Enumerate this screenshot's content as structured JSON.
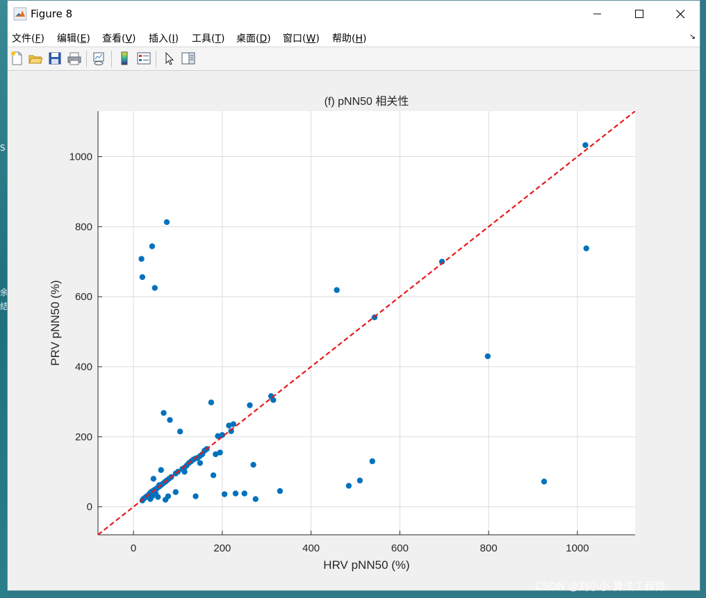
{
  "window": {
    "title": "Figure 8",
    "app_icon": "matlab-logo-icon"
  },
  "desktop": {
    "fragments": [
      "S",
      "余",
      "结"
    ]
  },
  "menu": [
    {
      "label": "文件(F)",
      "mn": "F"
    },
    {
      "label": "编辑(E)",
      "mn": "E"
    },
    {
      "label": "查看(V)",
      "mn": "V"
    },
    {
      "label": "插入(I)",
      "mn": "I"
    },
    {
      "label": "工具(T)",
      "mn": "T"
    },
    {
      "label": "桌面(D)",
      "mn": "D"
    },
    {
      "label": "窗口(W)",
      "mn": "W"
    },
    {
      "label": "帮助(H)",
      "mn": "H"
    }
  ],
  "menu_corner": "↘",
  "toolbar": [
    {
      "name": "new-figure-icon"
    },
    {
      "name": "open-file-icon"
    },
    {
      "name": "save-icon"
    },
    {
      "name": "print-icon"
    },
    {
      "name": "link-plot-icon"
    },
    {
      "name": "colorbar-icon"
    },
    {
      "name": "legend-icon"
    },
    {
      "name": "pointer-icon"
    },
    {
      "name": "property-editor-icon"
    }
  ],
  "chart_data": {
    "type": "scatter",
    "title": "(f) pNN50 相关性",
    "xlabel": "HRV pNN50 (%)",
    "ylabel": "PRV pNN50 (%)",
    "xlim": [
      -80,
      1130
    ],
    "ylim": [
      -80,
      1130
    ],
    "xticks": [
      0,
      200,
      400,
      600,
      800,
      1000
    ],
    "yticks": [
      0,
      200,
      400,
      600,
      800,
      1000
    ],
    "grid": true,
    "point_color": "#0072bd",
    "identity_line": {
      "style": "dashed",
      "color": "#e41a1c",
      "from": -80,
      "to": 1130
    },
    "series": [
      {
        "x": [
          20,
          22,
          25,
          28,
          30,
          33,
          35,
          37,
          38,
          40,
          42,
          45,
          47,
          50,
          52,
          55,
          58,
          60,
          62,
          65,
          70,
          72,
          75,
          80,
          85,
          95,
          100,
          110,
          115,
          120,
          125,
          130,
          135,
          140,
          145,
          150,
          155,
          160,
          165,
          38,
          42,
          45,
          48,
          50,
          55,
          58,
          62,
          68,
          72,
          78,
          82,
          95,
          105,
          115,
          140,
          150,
          175,
          180,
          185,
          190,
          195,
          200,
          205,
          215,
          220,
          225,
          230,
          250,
          262,
          270,
          275,
          310,
          315,
          330,
          18,
          20,
          42,
          48,
          75,
          458,
          485,
          510,
          538,
          543,
          695,
          798,
          925,
          1018,
          1020
        ],
        "y": [
          18,
          22,
          25,
          28,
          30,
          32,
          35,
          38,
          40,
          42,
          44,
          46,
          48,
          50,
          52,
          55,
          58,
          60,
          62,
          65,
          70,
          72,
          75,
          80,
          85,
          95,
          100,
          108,
          112,
          118,
          125,
          130,
          135,
          138,
          140,
          145,
          150,
          160,
          165,
          22,
          30,
          80,
          48,
          38,
          28,
          62,
          105,
          268,
          20,
          30,
          248,
          42,
          215,
          100,
          30,
          125,
          298,
          90,
          150,
          202,
          155,
          205,
          36,
          232,
          216,
          236,
          38,
          38,
          290,
          120,
          22,
          316,
          305,
          45,
          708,
          656,
          744,
          625,
          813,
          619,
          60,
          75,
          130,
          541,
          700,
          430,
          72,
          1033,
          738
        ]
      }
    ]
  },
  "watermark": "CSDN @刘小小 算法工程师"
}
